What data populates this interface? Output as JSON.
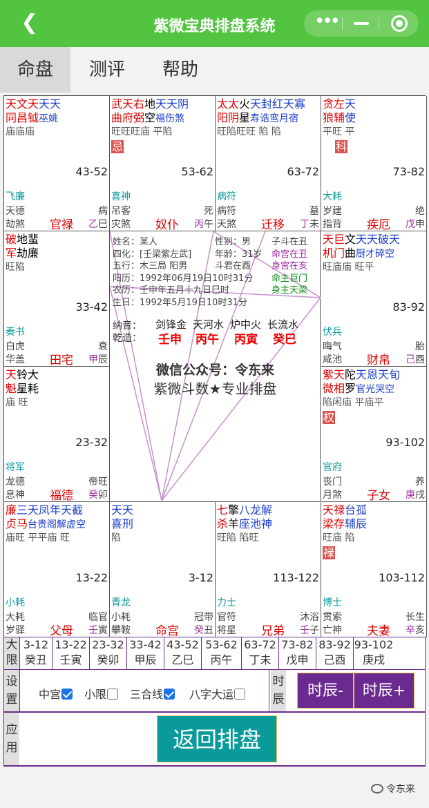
{
  "header": {
    "title": "紫微宝典排盘系统",
    "back": "<"
  },
  "tabs": [
    "命盘",
    "测评",
    "帮助"
  ],
  "palaces": [
    {
      "s1": [
        [
          "天文天",
          "red"
        ],
        [
          "天天",
          "blue"
        ]
      ],
      "s2": [
        [
          "同昌钺",
          "red"
        ],
        [
          "巫姚",
          "blue sm"
        ]
      ],
      "s3": "庙庙庙",
      "hua": "",
      "age": "43-52",
      "b1": "飞廉",
      "b2": "天德",
      "b2r": "病",
      "b3": "劫煞",
      "pal": "官禄",
      "gz1": "乙",
      "gz2": "巳"
    },
    {
      "s1": [
        [
          "武天右",
          "red"
        ],
        [
          "地",
          "dark"
        ],
        [
          "天天阴",
          "blue"
        ]
      ],
      "s2": [
        [
          "曲府弼",
          "red"
        ],
        [
          "空",
          "dark"
        ],
        [
          "福伤煞",
          "blue sm"
        ]
      ],
      "s3": "旺旺旺庙 平陷",
      "hua": "忌",
      "age": "53-62",
      "b1": "喜神",
      "b2": "吊客",
      "b2r": "死",
      "b3": "灾煞",
      "pal": "奴仆",
      "gz1": "丙",
      "gz2": "午"
    },
    {
      "s1": [
        [
          "太太",
          "red"
        ],
        [
          "火",
          "dark"
        ],
        [
          "天封红天寡",
          "blue"
        ]
      ],
      "s2": [
        [
          "阳阴",
          "red"
        ],
        [
          "星",
          "dark"
        ],
        [
          "寿诰鸾月宿",
          "blue sm"
        ]
      ],
      "s3": "旺陷旺旺 陷 陷",
      "hua": "",
      "age": "63-72",
      "b1": "病符",
      "b2": "病符",
      "b2r": "墓",
      "b3": "天煞",
      "pal": "迁移",
      "gz1": "丁",
      "gz2": "未"
    },
    {
      "s1": [
        [
          "贪左",
          "red"
        ],
        [
          "天",
          "blue"
        ]
      ],
      "s2": [
        [
          "狼辅",
          "red"
        ],
        [
          "使",
          "blue"
        ]
      ],
      "s3": "平旺 平",
      "hua": "科",
      "huaPos": "mid",
      "age": "73-82",
      "b1": "大耗",
      "b2": "岁建",
      "b2r": "绝",
      "b3": "指背",
      "pal": "疾厄",
      "gz1": "戊",
      "gz2": "申"
    },
    {
      "s1": [
        [
          "破",
          "red"
        ],
        [
          "地蜚",
          "dark"
        ]
      ],
      "s2": [
        [
          "军",
          "red"
        ],
        [
          "劫廉",
          "dark"
        ]
      ],
      "s3": "旺陷",
      "hua": "",
      "age": "33-42",
      "b1": "奏书",
      "b2": "白虎",
      "b2r": "衰",
      "b3": "华盖",
      "pal": "田宅",
      "gz1": "甲",
      "gz2": "辰"
    },
    {
      "s1": [
        [
          "天巨",
          "red"
        ],
        [
          "文",
          "dark"
        ],
        [
          "天天破天",
          "blue"
        ]
      ],
      "s2": [
        [
          "机门",
          "red"
        ],
        [
          "曲",
          "dark"
        ],
        [
          "厨才碎空",
          "blue sm"
        ]
      ],
      "s3": "旺庙庙 旺平",
      "hua": "",
      "age": "83-92",
      "b1": "伏兵",
      "b2": "晦气",
      "b2r": "胎",
      "b3": "咸池",
      "pal": "财帛",
      "gz1": "己",
      "gz2": "酉"
    },
    {
      "s1": [
        [
          "天",
          "red"
        ],
        [
          "铃大",
          "dark"
        ]
      ],
      "s2": [
        [
          "魁",
          "red"
        ],
        [
          "星耗",
          "dark"
        ]
      ],
      "s3": "庙 旺",
      "hua": "",
      "age": "23-32",
      "b1": "将军",
      "b2": "龙德",
      "b2r": "帝旺",
      "b3": "息神",
      "pal": "福德",
      "gz1": "癸",
      "gz2": "卯"
    },
    {
      "s1": [
        [
          "紫天",
          "red"
        ],
        [
          "陀",
          "dark"
        ],
        [
          "天恩天旬",
          "blue"
        ]
      ],
      "s2": [
        [
          "微相",
          "red"
        ],
        [
          "罗",
          "dark"
        ],
        [
          "官光哭空",
          "blue sm"
        ]
      ],
      "s3": "陷闲庙 平庙平",
      "hua": "权",
      "age": "93-102",
      "b1": "官府",
      "b2": "丧门",
      "b2r": "养",
      "b3": "月煞",
      "pal": "子女",
      "gz1": "庚",
      "gz2": "戌"
    },
    {
      "s1": [
        [
          "廉",
          "red"
        ],
        [
          "三天凤年天截",
          "blue"
        ]
      ],
      "s2": [
        [
          "贞马",
          "red"
        ],
        [
          "台贵阁解虚空",
          "blue sm"
        ]
      ],
      "s3": "庙旺 平平庙 旺",
      "hua": "",
      "age": "13-22",
      "b1": "小耗",
      "b2": "大耗",
      "b2r": "临官",
      "b3": "岁驿",
      "pal": "父母",
      "gz1": "壬",
      "gz2": "寅"
    },
    {
      "s1": [
        [
          "天天",
          "blue"
        ]
      ],
      "s2": [
        [
          "喜刑",
          "blue"
        ]
      ],
      "s3": "陷",
      "hua": "",
      "age": "3-12",
      "b1": "青龙",
      "b2": "小耗",
      "b2r": "冠带",
      "b3": "攀鞍",
      "pal": "命宫",
      "gz1": "癸",
      "gz2": "丑"
    },
    {
      "s1": [
        [
          "七",
          "red"
        ],
        [
          "擎",
          "dark"
        ],
        [
          "八龙解",
          "blue"
        ]
      ],
      "s2": [
        [
          "杀",
          "red"
        ],
        [
          "羊",
          "dark"
        ],
        [
          "座池神",
          "blue"
        ]
      ],
      "s3": "旺陷 陷旺",
      "hua": "",
      "age": "113-122",
      "b1": "力士",
      "b2": "官符",
      "b2r": "沐浴",
      "b3": "将星",
      "pal": "兄弟",
      "gz1": "壬",
      "gz2": "子"
    },
    {
      "s1": [
        [
          "天禄",
          "red"
        ],
        [
          "台孤",
          "blue"
        ]
      ],
      "s2": [
        [
          "梁存",
          "red"
        ],
        [
          "辅辰",
          "blue"
        ]
      ],
      "s3": "旺庙 陷",
      "hua": "禄",
      "age": "103-112",
      "b1": "博士",
      "b2": "贯索",
      "b2r": "长生",
      "b3": "亡神",
      "pal": "夫妻",
      "gz1": "辛",
      "gz2": "亥"
    }
  ],
  "center": {
    "info": [
      {
        "l": "姓名：",
        "v": "某人",
        "r": "子斗在丑",
        "rc": "dark"
      },
      {
        "l": "四化：",
        "v": "[壬梁紫左武]",
        "r": "命宫在丑",
        "rc": "pur"
      },
      {
        "l": "五行：",
        "v": "木三局 阳男",
        "r": "身宫在亥",
        "rc": "pur"
      },
      {
        "l": "阳历：",
        "v": "1992年06月19日10时31分",
        "r": "命主巨门",
        "rc": "grn"
      },
      {
        "l": "农历：",
        "v": "壬申年五月十九日巳时",
        "r": "身主天梁",
        "rc": "grn"
      },
      {
        "l": "生日：",
        "v": "1992年5月19日10时31分",
        "r": "",
        "rc": "dark"
      }
    ],
    "misc": {
      "sex_l": "性别：",
      "sex": "男",
      "age_l": "年龄：",
      "age": "31岁",
      "dou": "斗君在酉"
    },
    "nayin_label": "纳音：",
    "nayin": [
      "剑锋金",
      "天河水",
      "炉中火",
      "长流水"
    ],
    "ganzhi_label": "乾造：",
    "ganzhi": [
      "壬申",
      "丙午",
      "丙寅",
      "癸巳"
    ],
    "wechat": "微信公众号：令东来",
    "slogan": "紫微斗数★专业排盘"
  },
  "daxian": {
    "label": "大限",
    "items": [
      [
        "3-12",
        "癸丑"
      ],
      [
        "13-22",
        "壬寅"
      ],
      [
        "23-32",
        "癸卯"
      ],
      [
        "33-42",
        "甲辰"
      ],
      [
        "43-52",
        "乙巳"
      ],
      [
        "53-62",
        "丙午"
      ],
      [
        "63-72",
        "丁未"
      ],
      [
        "73-82",
        "戊申"
      ],
      [
        "83-92",
        "己酉"
      ],
      [
        "93-102",
        "庚戌"
      ]
    ]
  },
  "settings": {
    "label": "设置",
    "opts": [
      {
        "t": "中宫",
        "on": true
      },
      {
        "t": "小限",
        "on": false
      },
      {
        "t": "三合线",
        "on": true
      },
      {
        "t": "八字大运",
        "on": false
      }
    ],
    "sc_label": "时辰",
    "prev": "时辰-",
    "next": "时辰+"
  },
  "apply": {
    "label": "应用",
    "back": "返回排盘"
  },
  "footer": "令东来"
}
